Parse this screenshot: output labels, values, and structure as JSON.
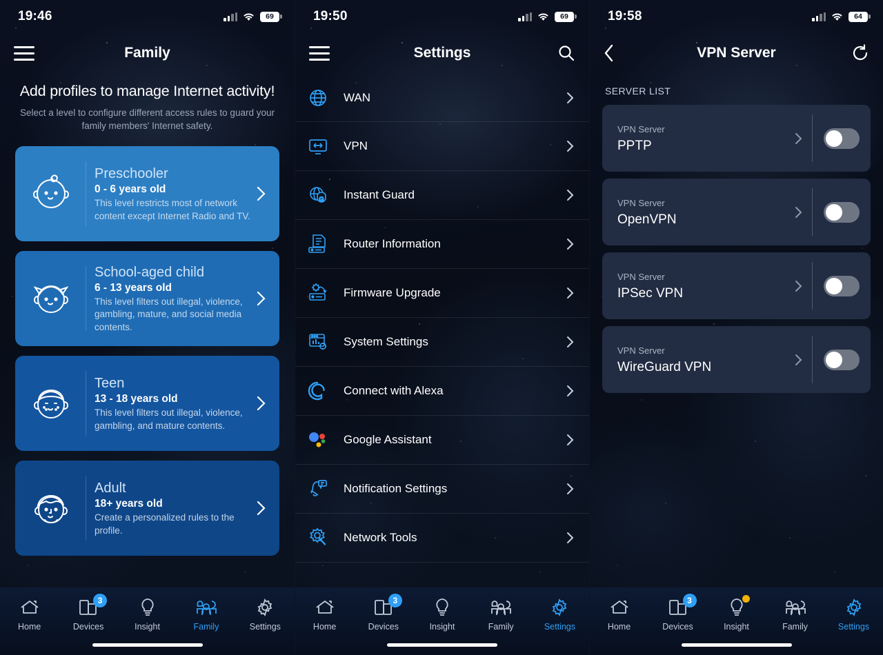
{
  "panels": [
    {
      "status": {
        "time": "19:46",
        "battery": "69",
        "wifi_icon": "wifi-icon",
        "signal_icon": "cellular-signal-icon"
      },
      "nav": {
        "menu_icon": "hamburger-menu-icon",
        "title": "Family"
      },
      "family": {
        "heading": "Add profiles to manage Internet activity!",
        "subheading": "Select a level to configure different access rules to guard your family members' Internet safety.",
        "profiles": [
          {
            "name": "Preschooler",
            "age": "0 - 6 years old",
            "desc": "This level restricts most of network content except Internet Radio and TV.",
            "avatar_icon": "baby-face-icon",
            "chevron_icon": "chevron-right-icon",
            "color": "#2d7fc4"
          },
          {
            "name": "School-aged child",
            "age": "6 - 13 years old",
            "desc": "This level filters out illegal, violence, gambling, mature, and social media contents.",
            "avatar_icon": "girl-face-icon",
            "chevron_icon": "chevron-right-icon",
            "color": "#1f6cb4"
          },
          {
            "name": "Teen",
            "age": "13 - 18 years old",
            "desc": "This level filters out illegal, violence, gambling, and mature contents.",
            "avatar_icon": "teen-boy-face-icon",
            "chevron_icon": "chevron-right-icon",
            "color": "#14559f"
          },
          {
            "name": "Adult",
            "age": "18+ years old",
            "desc": "Create a personalized rules to the profile.",
            "avatar_icon": "adult-man-face-icon",
            "chevron_icon": "chevron-right-icon",
            "color": "#0f4688"
          }
        ]
      },
      "tabs": [
        {
          "label": "Home",
          "icon": "home-icon",
          "active": false,
          "badge": "",
          "dot": false
        },
        {
          "label": "Devices",
          "icon": "devices-icon",
          "active": false,
          "badge": "3",
          "dot": false
        },
        {
          "label": "Insight",
          "icon": "lightbulb-icon",
          "active": false,
          "badge": "",
          "dot": false
        },
        {
          "label": "Family",
          "icon": "family-group-icon",
          "active": true,
          "badge": "",
          "dot": false
        },
        {
          "label": "Settings",
          "icon": "gear-icon",
          "active": false,
          "badge": "",
          "dot": false
        }
      ]
    },
    {
      "status": {
        "time": "19:50",
        "battery": "69",
        "wifi_icon": "wifi-icon",
        "signal_icon": "cellular-signal-icon"
      },
      "nav": {
        "menu_icon": "hamburger-menu-icon",
        "title": "Settings",
        "search_icon": "search-icon"
      },
      "settings_items": [
        {
          "label": "WAN",
          "icon": "globe-wan-icon",
          "chevron_icon": "chevron-right-icon"
        },
        {
          "label": "VPN",
          "icon": "vpn-monitor-icon",
          "chevron_icon": "chevron-right-icon"
        },
        {
          "label": "Instant Guard",
          "icon": "instant-guard-globe-icon",
          "chevron_icon": "chevron-right-icon"
        },
        {
          "label": "Router Information",
          "icon": "router-info-icon",
          "chevron_icon": "chevron-right-icon"
        },
        {
          "label": "Firmware Upgrade",
          "icon": "firmware-upgrade-icon",
          "chevron_icon": "chevron-right-icon"
        },
        {
          "label": "System Settings",
          "icon": "system-settings-icon",
          "chevron_icon": "chevron-right-icon"
        },
        {
          "label": "Connect with Alexa",
          "icon": "alexa-icon",
          "chevron_icon": "chevron-right-icon"
        },
        {
          "label": "Google Assistant",
          "icon": "google-assistant-icon",
          "chevron_icon": "chevron-right-icon"
        },
        {
          "label": "Notification Settings",
          "icon": "notification-bell-icon",
          "chevron_icon": "chevron-right-icon"
        },
        {
          "label": "Network Tools",
          "icon": "network-tools-icon",
          "chevron_icon": "chevron-right-icon"
        }
      ],
      "tabs": [
        {
          "label": "Home",
          "icon": "home-icon",
          "active": false,
          "badge": "",
          "dot": false
        },
        {
          "label": "Devices",
          "icon": "devices-icon",
          "active": false,
          "badge": "3",
          "dot": false
        },
        {
          "label": "Insight",
          "icon": "lightbulb-icon",
          "active": false,
          "badge": "",
          "dot": false
        },
        {
          "label": "Family",
          "icon": "family-group-icon",
          "active": false,
          "badge": "",
          "dot": false
        },
        {
          "label": "Settings",
          "icon": "gear-icon",
          "active": true,
          "badge": "",
          "dot": false
        }
      ]
    },
    {
      "status": {
        "time": "19:58",
        "battery": "64",
        "wifi_icon": "wifi-icon",
        "signal_icon": "cellular-signal-icon"
      },
      "nav": {
        "back_icon": "chevron-left-icon",
        "title": "VPN Server",
        "refresh_icon": "refresh-icon"
      },
      "vpn": {
        "section_label": "SERVER LIST",
        "servers": [
          {
            "sub": "VPN Server",
            "name": "PPTP",
            "enabled": false,
            "chevron_icon": "chevron-right-icon",
            "toggle_icon": "toggle-switch"
          },
          {
            "sub": "VPN Server",
            "name": "OpenVPN",
            "enabled": false,
            "chevron_icon": "chevron-right-icon",
            "toggle_icon": "toggle-switch"
          },
          {
            "sub": "VPN Server",
            "name": "IPSec VPN",
            "enabled": false,
            "chevron_icon": "chevron-right-icon",
            "toggle_icon": "toggle-switch"
          },
          {
            "sub": "VPN Server",
            "name": "WireGuard VPN",
            "enabled": false,
            "chevron_icon": "chevron-right-icon",
            "toggle_icon": "toggle-switch"
          }
        ]
      },
      "tabs": [
        {
          "label": "Home",
          "icon": "home-icon",
          "active": false,
          "badge": "",
          "dot": false
        },
        {
          "label": "Devices",
          "icon": "devices-icon",
          "active": false,
          "badge": "3",
          "dot": false
        },
        {
          "label": "Insight",
          "icon": "lightbulb-icon",
          "active": false,
          "badge": "",
          "dot": true
        },
        {
          "label": "Family",
          "icon": "family-group-icon",
          "active": false,
          "badge": "",
          "dot": false
        },
        {
          "label": "Settings",
          "icon": "gear-icon",
          "active": true,
          "badge": "",
          "dot": false
        }
      ]
    }
  ],
  "colors": {
    "accent": "#2f9ff5",
    "icon_blue": "#2f9ff5",
    "badge": "#2f9ff5",
    "dot": "#f2b207",
    "toggle_off": "#6e7684",
    "card": "#222c42"
  }
}
